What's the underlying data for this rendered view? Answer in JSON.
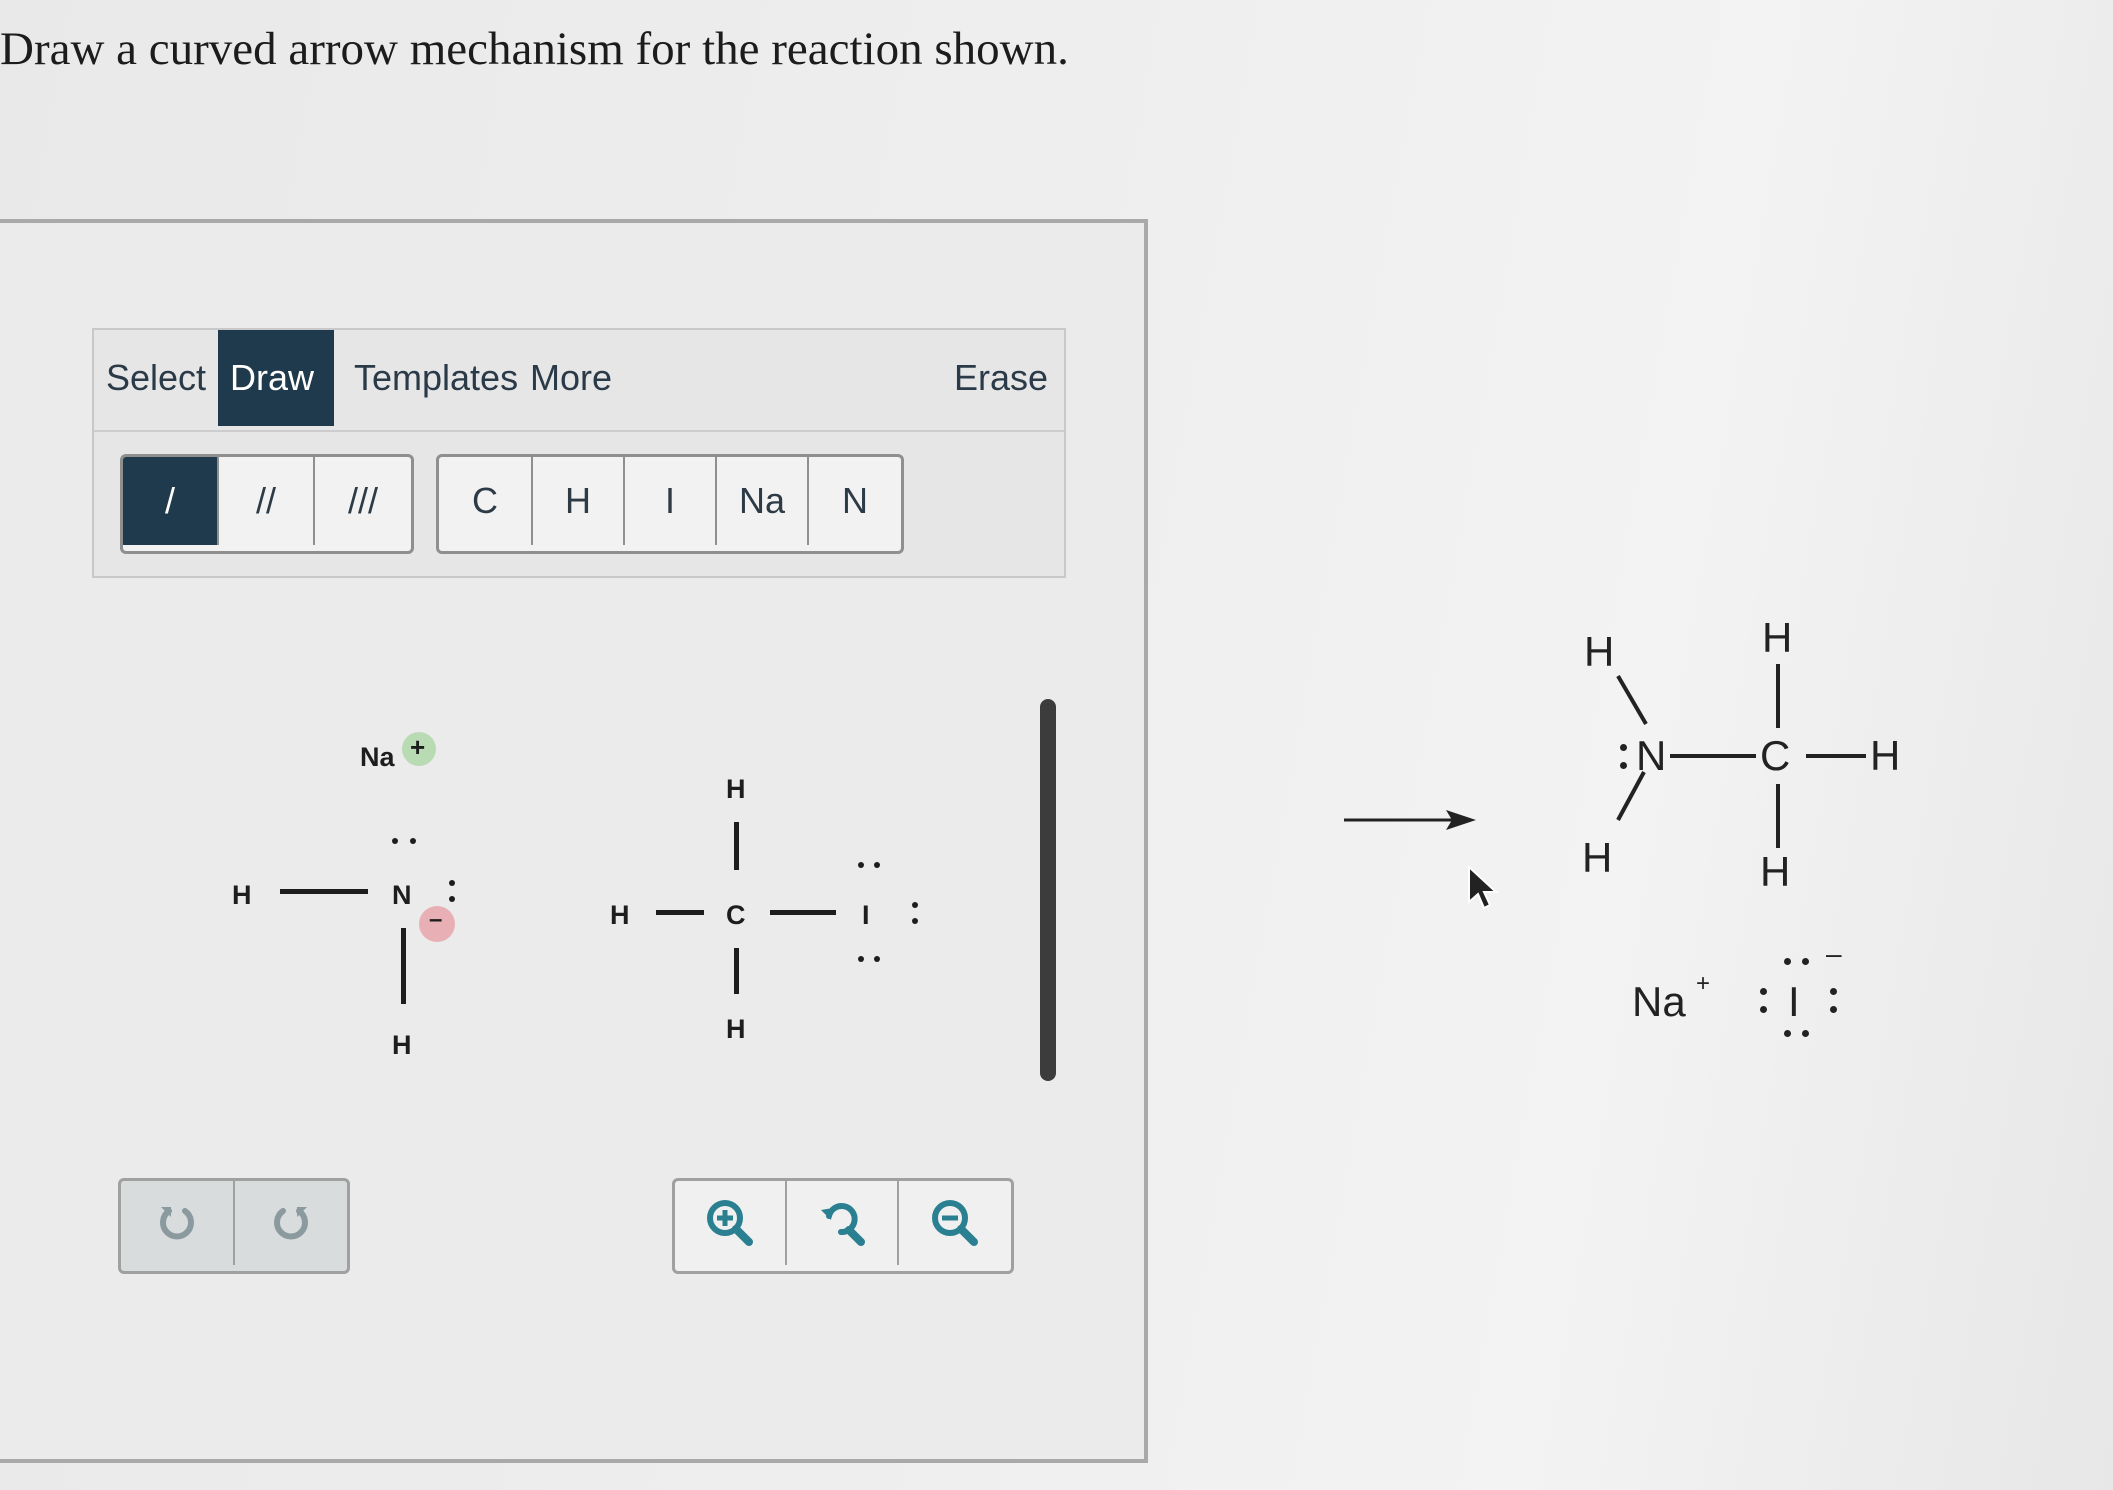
{
  "prompt": "Draw a curved arrow mechanism for the reaction shown.",
  "tabs": [
    {
      "label": "Select",
      "active": false
    },
    {
      "label": "Draw",
      "active": true
    },
    {
      "label": "Templates",
      "active": false
    },
    {
      "label": "More",
      "active": false
    },
    {
      "label": "Erase",
      "active": false
    }
  ],
  "bond_tools": [
    {
      "name": "single-bond",
      "glyph": "/",
      "active": true
    },
    {
      "name": "double-bond",
      "glyph": "//",
      "active": false
    },
    {
      "name": "triple-bond",
      "glyph": "///",
      "active": false
    }
  ],
  "atom_tools": [
    "C",
    "H",
    "I",
    "Na",
    "N"
  ],
  "canvas": {
    "na_label": "Na",
    "plus_sign": "+",
    "minus_sign": "–",
    "h_left": "H",
    "n_atom": "N",
    "h_below_n": "H",
    "h_top_c": "H",
    "h_left_c": "H",
    "c_atom": "C",
    "h_bottom_c": "H",
    "i_atom": "I"
  },
  "history_controls": [
    "undo-icon",
    "redo-icon"
  ],
  "zoom_controls": [
    "zoom-in-icon",
    "reset-zoom-icon",
    "zoom-out-icon"
  ],
  "product": {
    "h_upper_left": "H",
    "h_lower_left": "H",
    "n_atom": "N",
    "c_atom": "C",
    "h_top": "H",
    "h_right": "H",
    "h_bottom": "H",
    "na_label": "Na",
    "na_charge": "+",
    "iodide": "I",
    "iodide_charge": "–"
  },
  "colors": {
    "active_tab": "#1f3a4c",
    "zoom_icon": "#2a8090",
    "plus_badge": "#b9dbb4",
    "minus_badge": "#e8b0b4"
  }
}
